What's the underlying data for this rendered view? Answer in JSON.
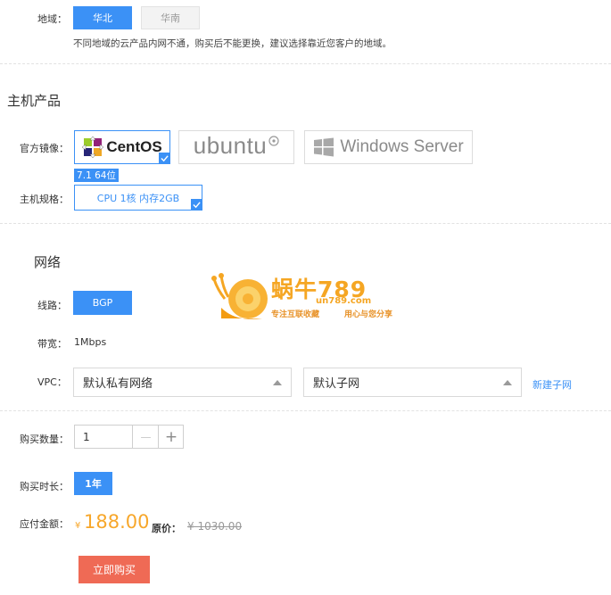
{
  "region": {
    "label": "地域：",
    "options": [
      "华北",
      "华南"
    ],
    "selected": "华北",
    "note": "不同地域的云产品内网不通，购买后不能更换，建议选择靠近您客户的地域。"
  },
  "host": {
    "section_title": "主机产品",
    "image_label": "官方镜像：",
    "images": [
      {
        "name": "CentOS",
        "selected": true
      },
      {
        "name": "ubuntu",
        "selected": false
      },
      {
        "name": "Windows Server",
        "selected": false
      }
    ],
    "version_badge": "7.1 64位",
    "spec_label": "主机规格：",
    "spec_value": "CPU 1核 内存2GB"
  },
  "network": {
    "section_title": "网络",
    "line_label": "线路：",
    "line_value": "BGP",
    "bandwidth_label": "带宽：",
    "bandwidth_value": "1Mbps",
    "vpc_label": "VPC：",
    "vpc_value": "默认私有网络",
    "subnet_value": "默认子网",
    "new_subnet_link": "新建子网"
  },
  "purchase": {
    "quantity_label": "购买数量：",
    "quantity_value": "1",
    "minus": "—",
    "plus": "+",
    "duration_label": "购买时长：",
    "duration_value": "1年",
    "amount_label": "应付金额：",
    "currency": "¥",
    "price": "188.00",
    "original_label": "原价：",
    "original_price": "¥ 1030.00",
    "buy_button": "立即购买"
  },
  "watermark": {
    "brand": "蜗牛789",
    "domain": "un789.com",
    "slogan_left": "专注互联收藏",
    "slogan_right": "用心与您分享"
  },
  "colors": {
    "accent": "#3b91f6",
    "price": "#f7a72b",
    "buy_button": "#ef6a55",
    "link": "#3b91f6"
  }
}
